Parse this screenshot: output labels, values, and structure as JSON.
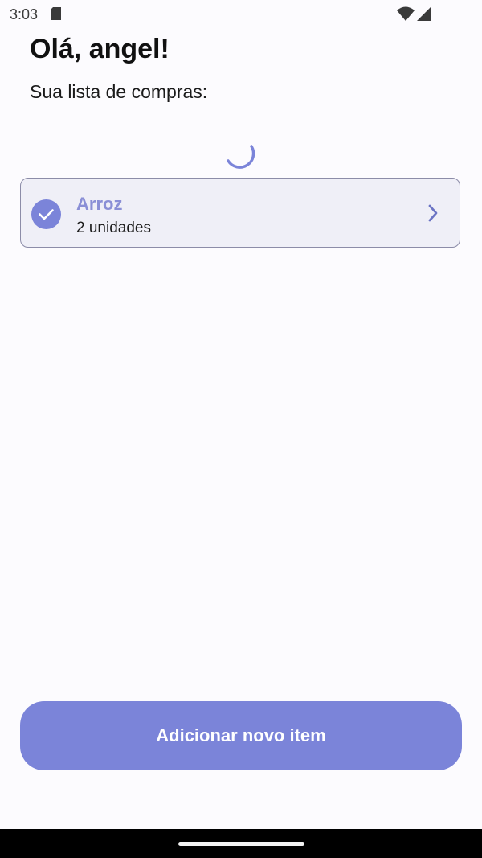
{
  "status_bar": {
    "time": "3:03",
    "icons": [
      "sim-card-icon",
      "wifi-icon",
      "cell-signal-icon"
    ]
  },
  "header": {
    "greeting": "Olá, angel!",
    "subtitle": "Sua lista de compras:"
  },
  "loading": {
    "icon": "loading-spinner-icon"
  },
  "list": {
    "items": [
      {
        "name": "Arroz",
        "quantity": "2 unidades",
        "checked": true,
        "icon": "check-circle-icon",
        "action_icon": "chevron-right-icon"
      }
    ]
  },
  "actions": {
    "add_label": "Adicionar novo item"
  },
  "colors": {
    "accent": "#7b84d9",
    "item_name": "#8a8fd6",
    "card_background": "#efeff7",
    "card_border": "#8c8ca8",
    "background": "#fcfbfe"
  }
}
